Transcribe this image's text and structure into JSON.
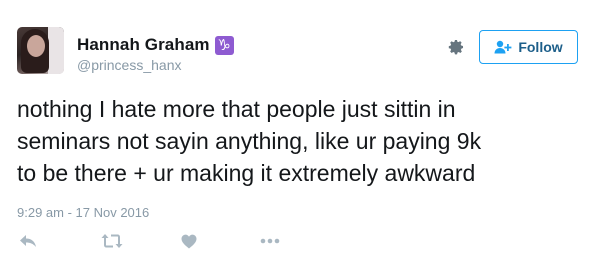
{
  "user": {
    "display_name": "Hannah Graham",
    "handle": "@princess_hanx",
    "emoji_badge": "♑",
    "badge_color": "#8e5bd1"
  },
  "follow_button": {
    "label": "Follow",
    "accent": "#1da1f2"
  },
  "tweet": {
    "text": "nothing I hate more that people just sittin in\nseminars not sayin anything, like ur paying 9k\nto be there + ur making it extremely awkward",
    "timestamp": "9:29 am - 17 Nov 2016"
  },
  "actions": [
    {
      "name": "reply",
      "icon": "reply-icon"
    },
    {
      "name": "retweet",
      "icon": "retweet-icon"
    },
    {
      "name": "like",
      "icon": "heart-icon"
    },
    {
      "name": "more",
      "icon": "more-icon"
    }
  ],
  "colors": {
    "muted": "#8899a6",
    "text": "#14171a",
    "icon": "#aab8c2"
  }
}
